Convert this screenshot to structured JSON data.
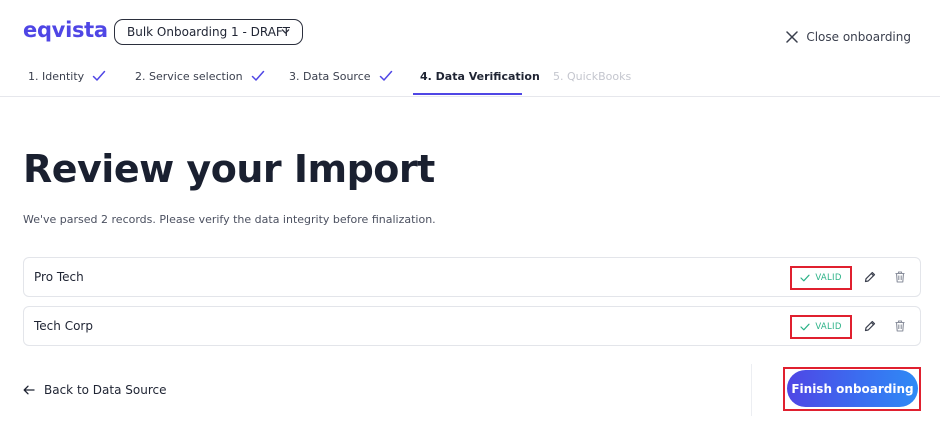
{
  "header": {
    "logo_text": "eqvista",
    "draft_select": "Bulk Onboarding 1 - DRAFT",
    "close_label": "Close onboarding"
  },
  "steps": [
    {
      "label": "1. Identity",
      "state": "complete"
    },
    {
      "label": "2. Service selection",
      "state": "complete"
    },
    {
      "label": "3. Data Source",
      "state": "complete"
    },
    {
      "label": "4. Data Verification",
      "state": "active"
    },
    {
      "label": "5. QuickBooks",
      "state": "disabled"
    }
  ],
  "main": {
    "title": "Review your Import",
    "subtitle": "We've parsed 2 records. Please verify the data integrity before finalization.",
    "records": [
      {
        "name": "Pro Tech",
        "status": "VALID"
      },
      {
        "name": "Tech Corp",
        "status": "VALID"
      }
    ]
  },
  "footer": {
    "back_label": "Back to Data Source",
    "finish_label": "Finish onboarding"
  },
  "icons": {
    "close": "close-icon",
    "chevron": "chevron-down-icon",
    "check": "check-icon",
    "edit": "pencil-icon",
    "delete": "trash-icon",
    "back": "arrow-left-icon"
  },
  "colors": {
    "brand": "#4f46e5",
    "valid": "#2bb287",
    "highlight": "#e0202f",
    "button_gradient_end": "#2f8af5"
  }
}
